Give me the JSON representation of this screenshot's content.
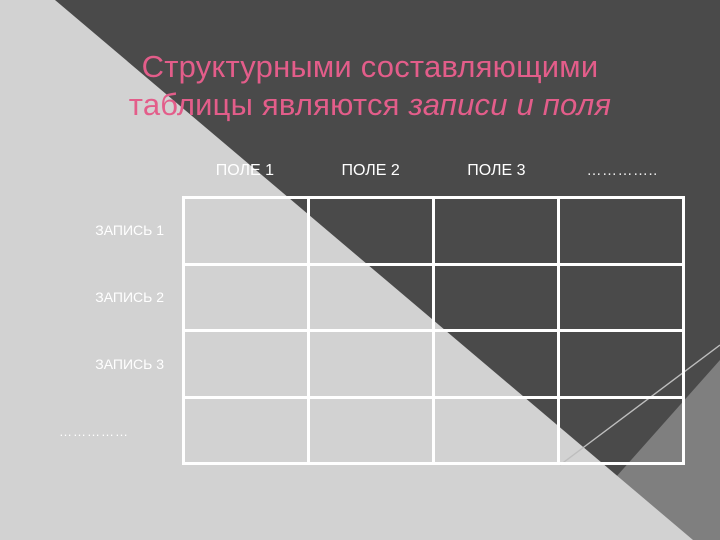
{
  "slide": {
    "title": {
      "line1": "Структурными составляющими",
      "line2_normal": "таблицы являются ",
      "line2_italic": "записи и поля"
    },
    "colors": {
      "title_pink": "#e35d8a",
      "background_dark": "#4a4a4a",
      "background_light": "#d2d2d2",
      "background_mid": "#7f7f7f",
      "grid_line": "#ffffff"
    }
  },
  "table": {
    "column_headers": [
      "ПОЛЕ 1",
      "ПОЛЕ 2",
      "ПОЛЕ 3",
      "………….."
    ],
    "row_labels": [
      "ЗАПИСЬ 1",
      "ЗАПИСЬ 2",
      "ЗАПИСЬ 3",
      "……………"
    ],
    "rows": 4,
    "columns": 4,
    "cells": [
      [
        "",
        "",
        "",
        ""
      ],
      [
        "",
        "",
        "",
        ""
      ],
      [
        "",
        "",
        "",
        ""
      ],
      [
        "",
        "",
        "",
        ""
      ]
    ]
  }
}
